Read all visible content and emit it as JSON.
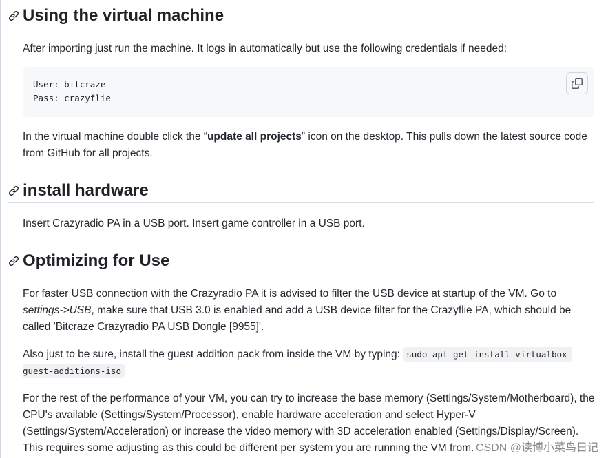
{
  "sections": {
    "vm": {
      "heading": "Using the virtual machine",
      "intro": "After importing just run the machine. It logs in automatically but use the following credentials if needed:",
      "code_lines": [
        "User: bitcraze",
        "Pass: crazyflie"
      ],
      "desktop_before": "In the virtual machine double click the “",
      "desktop_bold": "update all projects",
      "desktop_after": "” icon on the desktop. This pulls down the latest source code from GitHub for all projects."
    },
    "hardware": {
      "heading": "install hardware",
      "text": "Insert Crazyradio PA in a USB port. Insert game controller in a USB port."
    },
    "optimizing": {
      "heading": "Optimizing for Use",
      "p1_before": "For faster USB connection with the Crazyradio PA it is advised to filter the USB device at startup of the VM. Go to ",
      "p1_italic": "settings->USB",
      "p1_after": ", make sure that USB 3.0 is enabled and add a USB device filter for the Crazyflie PA, which should be called 'Bitcraze Crazyradio PA USB Dongle [9955]'.",
      "p2_before": "Also just to be sure, install the guest addition pack from inside the VM by typing: ",
      "p2_code": "sudo apt-get install virtualbox-guest-additions-iso",
      "p3": "For the rest of the performance of your VM, you can try to increase the base memory (Settings/System/Motherboard), the CPU's available (Settings/System/Processor), enable hardware acceleration and select Hyper-V (Settings/System/Acceleration) or increase the video memory with 3D acceleration enabled (Settings/Display/Screen). This requires some adjusting as this could be different per system you are running the VM from."
    }
  },
  "watermark": "CSDN @读博小菜鸟日记",
  "icons": {
    "heading_anchor": "link-icon",
    "copy": "copy-icon"
  },
  "colors": {
    "text": "#24292f",
    "code_bg": "#f6f8fa",
    "divider": "#d8dee4"
  }
}
